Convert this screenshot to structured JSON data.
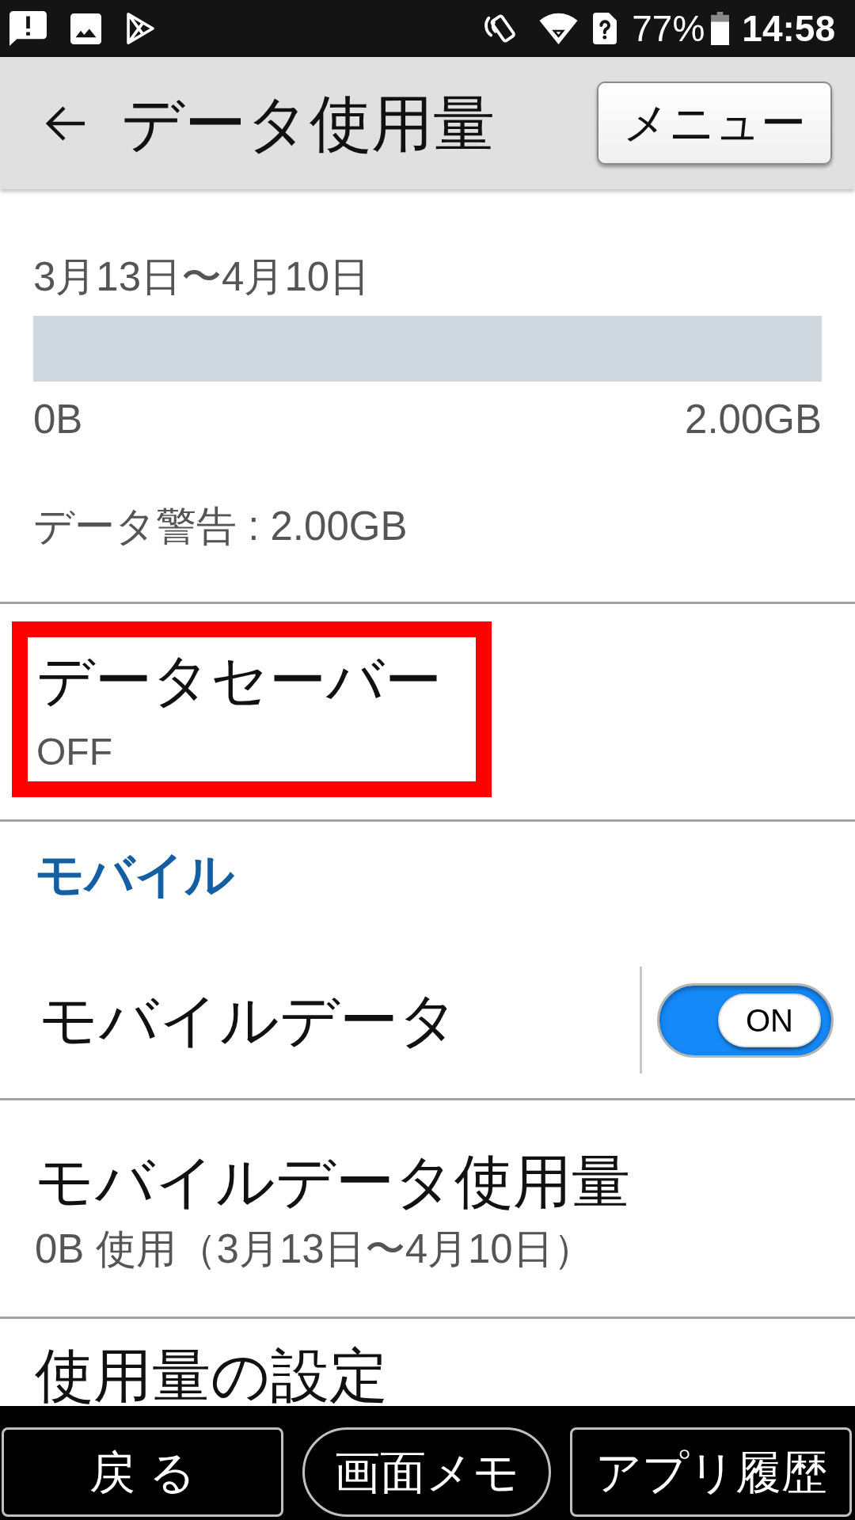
{
  "status_bar": {
    "battery_percent": "77%",
    "time": "14:58"
  },
  "header": {
    "title": "データ使用量",
    "menu_button": "メニュー"
  },
  "usage_summary": {
    "period": "3月13日〜4月10日",
    "min_label": "0B",
    "max_label": "2.00GB",
    "warning": "データ警告 : 2.00GB"
  },
  "data_saver": {
    "title": "データセーバー",
    "status": "OFF",
    "highlighted": true
  },
  "mobile_section": {
    "heading": "モバイル",
    "items": [
      {
        "kind": "toggle",
        "title": "モバイルデータ",
        "on": true,
        "toggle_text": "ON"
      },
      {
        "kind": "detail",
        "title": "モバイルデータ使用量",
        "subtitle": "0B 使用（3月13日〜4月10日）"
      },
      {
        "kind": "detail",
        "title": "使用量の設定"
      }
    ]
  },
  "nav_bar": {
    "buttons": [
      {
        "label": "戻 る",
        "kind": "rect"
      },
      {
        "label": "画面メモ",
        "kind": "pill"
      },
      {
        "label": "アプリ履歴",
        "kind": "rect"
      }
    ]
  }
}
